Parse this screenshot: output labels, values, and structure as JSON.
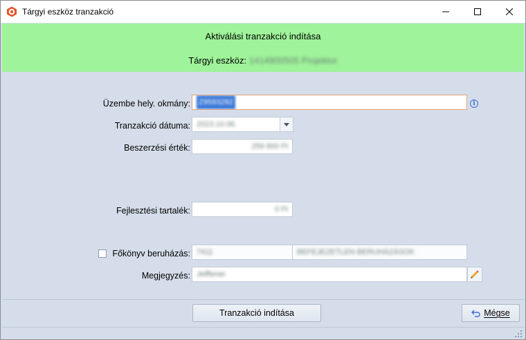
{
  "window": {
    "title": "Tárgyi eszköz tranzakció"
  },
  "header": {
    "title": "Aktiválási tranzakció indítása",
    "asset_label": "Tárgyi eszköz:",
    "asset_value": "1414900505 Projektor"
  },
  "form": {
    "document_label": "Üzembe hely. okmány:",
    "document_value": "Z9593292",
    "date_label": "Tranzakció dátuma:",
    "date_value": "2023.10.06.",
    "purchase_label": "Beszerzési érték:",
    "purchase_value": "259 800 Ft",
    "dev_reserve_label": "Fejlesztési tartalék:",
    "dev_reserve_value": "0 Ft",
    "ledger_label": "Főkönyv beruházás:",
    "ledger_code": "7411",
    "ledger_name": "BEFEJEZETLEN BERUHÁZÁSOK",
    "ledger_checked": false,
    "note_label": "Megjegyzés:",
    "note_value": "Jelffener"
  },
  "buttons": {
    "start": "Tranzakció indítása",
    "cancel": "Mégse"
  },
  "colors": {
    "header_bg": "#9ff39a",
    "form_bg": "#d4dde9",
    "accent_blue": "#3d6fd1"
  }
}
